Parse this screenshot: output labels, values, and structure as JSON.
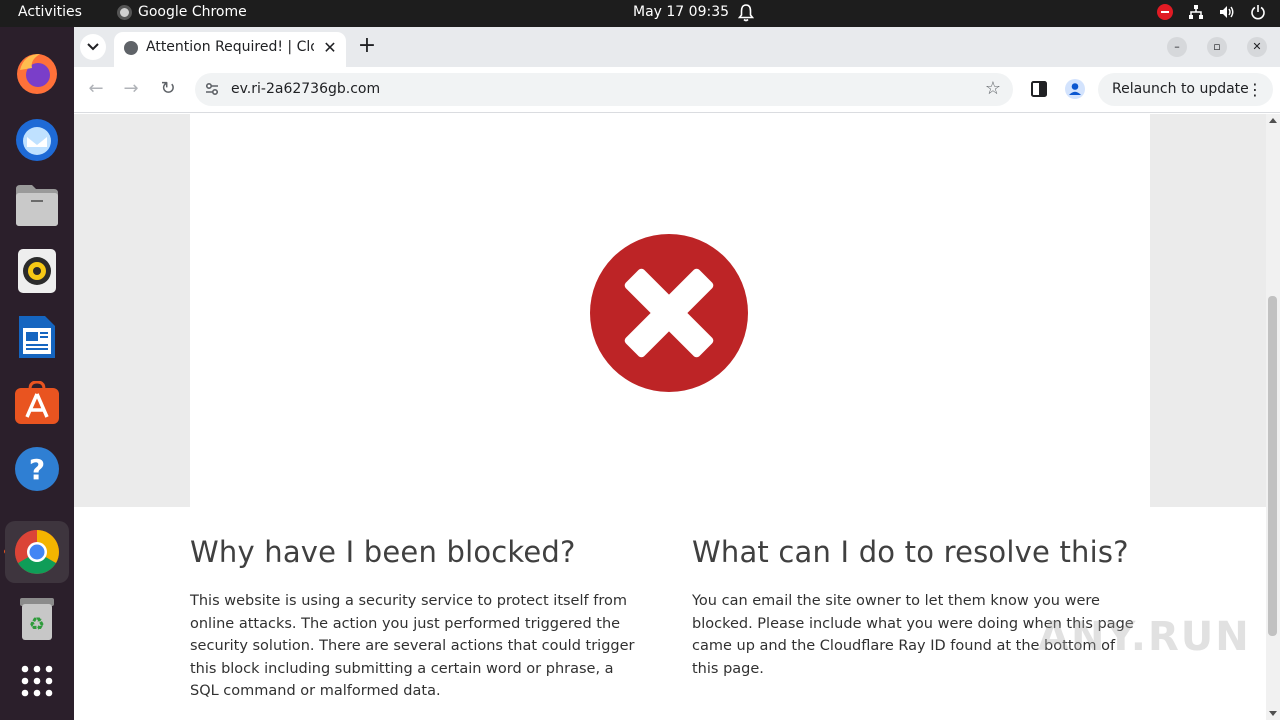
{
  "topbar": {
    "activities": "Activities",
    "app_name": "Google Chrome",
    "clock": "May 17  09:35"
  },
  "browser": {
    "tab_title": "Attention Required! | Cloudflare",
    "url": "ev.ri-2a62736gb.com",
    "relaunch_label": "Relaunch to update"
  },
  "page": {
    "left_heading": "Why have I been blocked?",
    "left_text": "This website is using a security service to protect itself from online attacks. The action you just performed triggered the security solution. There are several actions that could trigger this block including submitting a certain word or phrase, a SQL command or malformed data.",
    "right_heading": "What can I do to resolve this?",
    "right_text": "You can email the site owner to let them know you were blocked. Please include what you were doing when this page came up and the Cloudflare Ray ID found at the bottom of this page.",
    "watermark": "ANY.RUN"
  },
  "colors": {
    "error_red": "#bd2426",
    "ubuntu_orange": "#e95420"
  }
}
